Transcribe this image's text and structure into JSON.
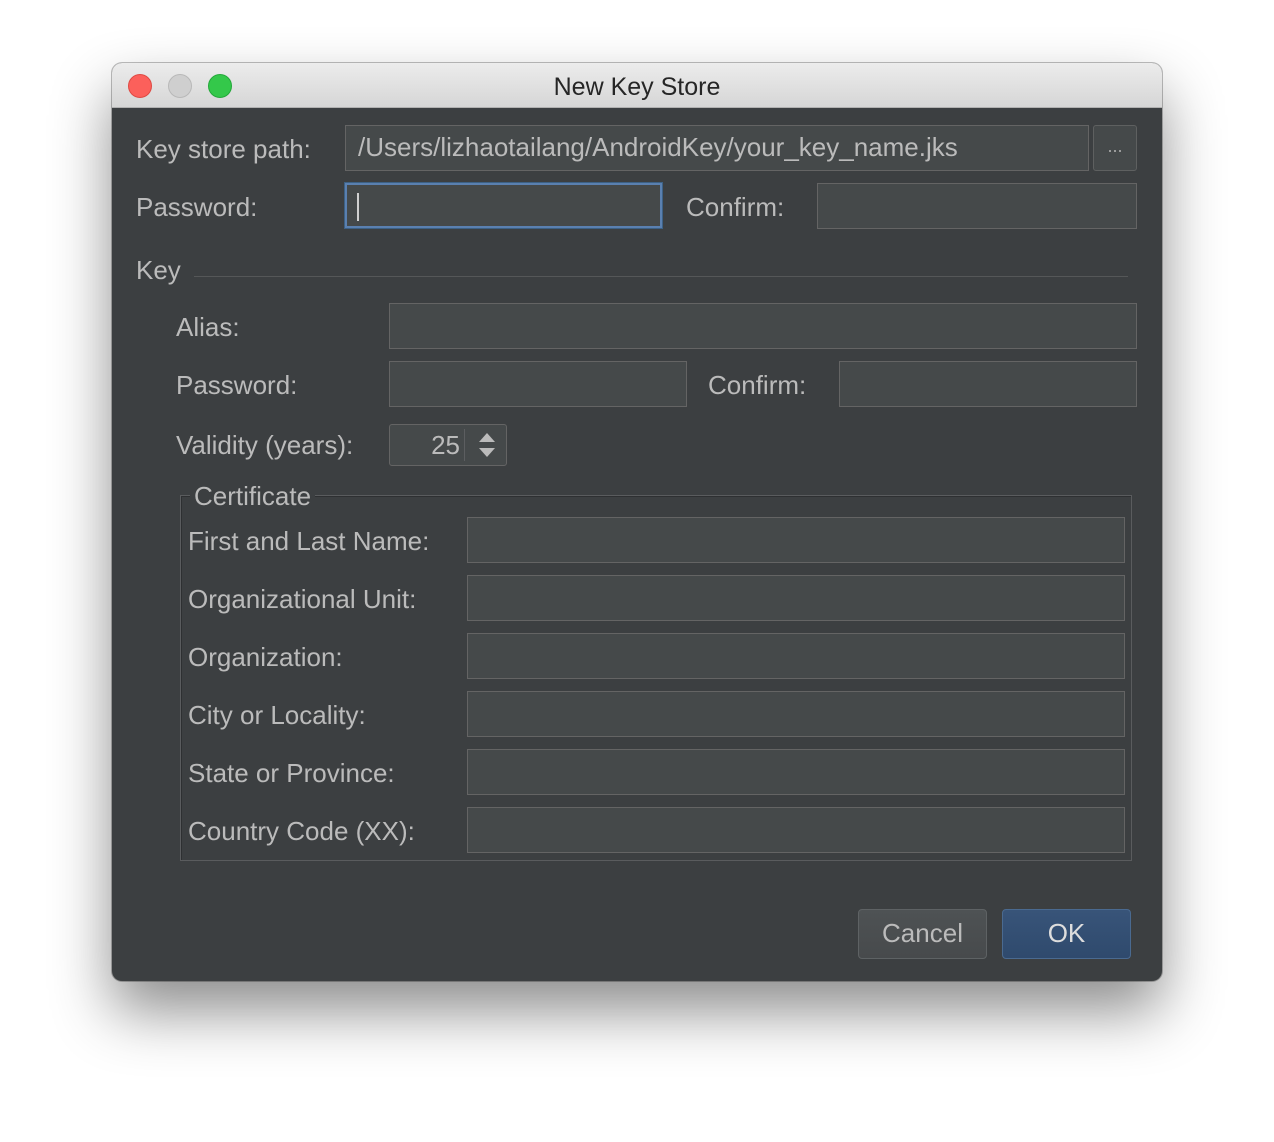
{
  "window": {
    "title": "New Key Store"
  },
  "keystore": {
    "path_label": "Key store path:",
    "path_value": "/Users/lizhaotailang/AndroidKey/your_key_name.jks",
    "browse_label": "...",
    "password_label": "Password:",
    "password_value": "",
    "confirm_label": "Confirm:",
    "confirm_value": ""
  },
  "key": {
    "section_label": "Key",
    "alias_label": "Alias:",
    "alias_value": "",
    "password_label": "Password:",
    "password_value": "",
    "confirm_label": "Confirm:",
    "confirm_value": "",
    "validity_label": "Validity (years):",
    "validity_value": "25"
  },
  "certificate": {
    "legend": "Certificate",
    "fields": [
      {
        "label": "First and Last Name:",
        "value": ""
      },
      {
        "label": "Organizational Unit:",
        "value": ""
      },
      {
        "label": "Organization:",
        "value": ""
      },
      {
        "label": "City or Locality:",
        "value": ""
      },
      {
        "label": "State or Province:",
        "value": ""
      },
      {
        "label": "Country Code (XX):",
        "value": ""
      }
    ]
  },
  "buttons": {
    "cancel": "Cancel",
    "ok": "OK"
  },
  "icons": {
    "close": "close-traffic-light-icon",
    "minimize": "minimize-traffic-light-icon",
    "maximize": "maximize-traffic-light-icon",
    "spinner_up": "chevron-up-icon",
    "spinner_down": "chevron-down-icon"
  },
  "colors": {
    "panel_bg": "#3c3f41",
    "field_bg": "#45494a",
    "text": "#bbbbbb",
    "focus_border": "#5a80b0",
    "ok_button": "#365880",
    "close": "#fc605b",
    "maximize": "#34c84a"
  }
}
